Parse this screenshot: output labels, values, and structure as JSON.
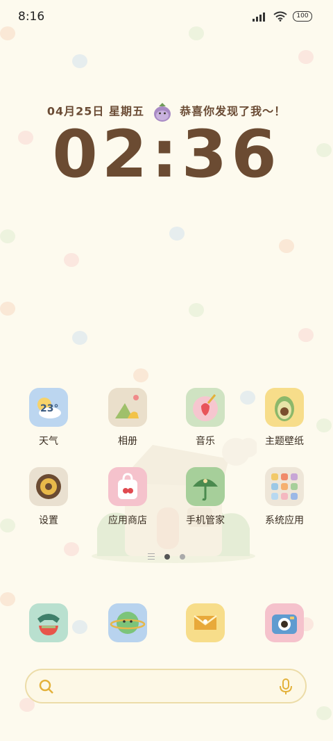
{
  "status_bar": {
    "time": "8:16",
    "battery": "100"
  },
  "lock_widget": {
    "date": "04月25日  星期五",
    "message": "恭喜你发现了我～！",
    "clock": "02:36"
  },
  "weather_icon_temp": "23°",
  "apps_row1": [
    {
      "label": "天气",
      "icon": "weather-icon"
    },
    {
      "label": "相册",
      "icon": "gallery-icon"
    },
    {
      "label": "音乐",
      "icon": "music-icon"
    },
    {
      "label": "主题壁纸",
      "icon": "themes-icon"
    }
  ],
  "apps_row2": [
    {
      "label": "设置",
      "icon": "settings-icon"
    },
    {
      "label": "应用商店",
      "icon": "app-store-icon"
    },
    {
      "label": "手机管家",
      "icon": "security-icon"
    },
    {
      "label": "系统应用",
      "icon": "system-apps-folder-icon"
    }
  ],
  "dock": [
    {
      "icon": "phone-icon"
    },
    {
      "icon": "browser-icon"
    },
    {
      "icon": "messages-icon"
    },
    {
      "icon": "camera-icon"
    }
  ],
  "search": {
    "placeholder": ""
  },
  "colors": {
    "background": "#fdfaee",
    "clock": "#6b4b32",
    "search_border": "#ecdca8"
  }
}
